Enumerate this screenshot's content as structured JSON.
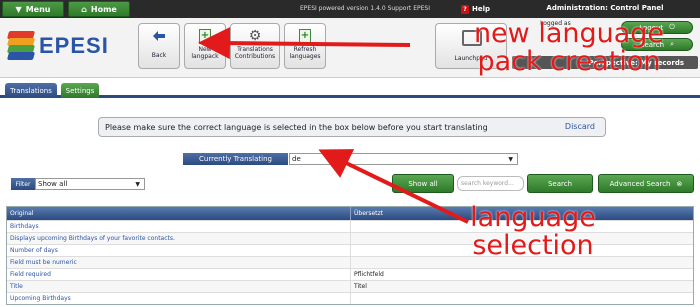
{
  "topbar": {
    "menu_label": "Menu",
    "home_label": "Home",
    "version_text": "EPESI powered  version 1.4.0  Support EPESI",
    "help_label": "Help",
    "admin_title": "Administration: Control Panel"
  },
  "logo": {
    "text": "EPESI"
  },
  "toolbar": {
    "back_label": "Back",
    "new_langpack_label": "New langpack",
    "translations_contrib_label": "Translations Contributions",
    "refresh_languages_label": "Refresh languages",
    "launchpad_label": "Launchpad"
  },
  "user": {
    "logged_as": "Logged as",
    "logout_label": "Logout",
    "search_label": "Search",
    "perspective_label": "Perspective: My records"
  },
  "tabs": [
    {
      "label": "Translations"
    },
    {
      "label": "Settings"
    }
  ],
  "notice": {
    "text": "Please make sure the correct language is selected in the box below before you start translating",
    "discard_label": "Discard"
  },
  "currently_translating": {
    "label": "Currently Translating",
    "value": "de"
  },
  "filter": {
    "label": "Filter",
    "value": "Show all",
    "show_all_label": "Show all",
    "keyword_placeholder": "search keyword...",
    "search_label": "Search",
    "advanced_search_label": "Advanced Search"
  },
  "table": {
    "columns": [
      "Original",
      "Übersetzt"
    ],
    "rows": [
      {
        "original": "Birthdays",
        "translated": ""
      },
      {
        "original": "Displays upcoming Birthdays of your favorite contacts.",
        "translated": ""
      },
      {
        "original": "Number of days",
        "translated": ""
      },
      {
        "original": "Field must be numeric",
        "translated": ""
      },
      {
        "original": "Field required",
        "translated": "Pflichtfeld"
      },
      {
        "original": "Title",
        "translated": "Titel"
      },
      {
        "original": "Upcoming Birthdays",
        "translated": ""
      }
    ]
  },
  "annotations": {
    "new_language_line1": "new language",
    "new_language_line2": "pack creation",
    "language_selection_line1": "language",
    "language_selection_line2": "selection"
  },
  "colors": {
    "green": "#2e7a2a",
    "blue": "#2a4a80",
    "annotation_red": "#e31a1a"
  }
}
